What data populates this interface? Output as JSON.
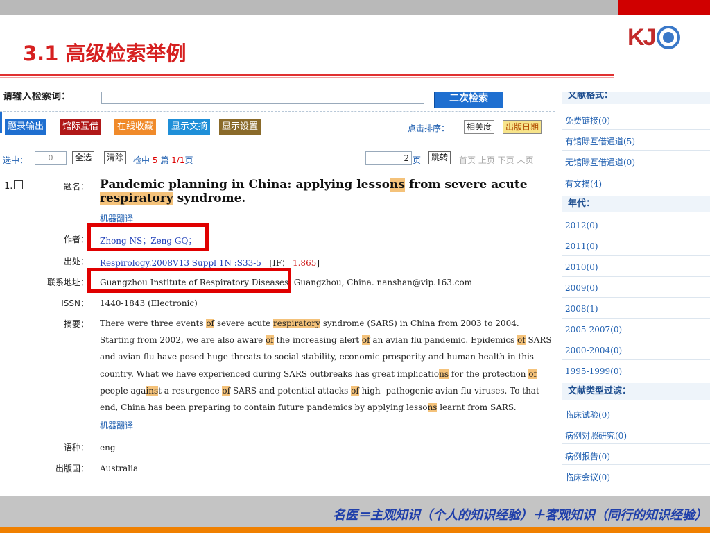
{
  "slide": {
    "title": "3.1 高级检索举例",
    "logo_text": "KJ",
    "footer": "名医＝主观知识（个人的知识经验）＋客观知识（同行的知识经验）"
  },
  "search": {
    "label": "请输入检索词：",
    "button": "二次检索"
  },
  "toolbar": {
    "buttons": [
      "题录输出",
      "馆际互借",
      "在线收藏",
      "显示文摘",
      "显示设置"
    ],
    "colors": [
      "#1f6fd0",
      "#b01818",
      "#f08a2a",
      "#1f8fd8",
      "#8a6a2a"
    ],
    "sort_label": "点击排序：",
    "sort_relevance": "相关度",
    "sort_date": "出版日期"
  },
  "selection": {
    "label": "选中：",
    "count": "0",
    "select_all": "全选",
    "clear": "清除",
    "hits_prefix": "检中",
    "hits_count": "5",
    "hits_mid": "篇",
    "page_pos": "1/1",
    "page_suffix": "页",
    "page_input": "2",
    "page_unit": "页",
    "jump": "跳转",
    "pager": "首页 上页 下页 末页"
  },
  "record": {
    "index": "1.",
    "labels": {
      "title": "题名：",
      "author": "作者：",
      "source": "出处：",
      "address": "联系地址：",
      "issn": "ISSN：",
      "abstract": "摘要：",
      "language": "语种：",
      "country": "出版国："
    },
    "title_parts": [
      "Pandemic planning in China: applying lesso",
      "ns",
      " from severe acute "
    ],
    "title_hl2": "respiratory",
    "title_end": " syndrome.",
    "machine_translate": "机器翻译",
    "authors": "Zhong NS；Zeng GQ；",
    "source_text": "Respirology.2008V13 Suppl 1N :S33-5",
    "if_label": "[IF：",
    "if_value": "1.865",
    "if_close": "]",
    "address": "Guangzhou Institute of Respiratory Diseases, Guangzhou, China. nanshan@vip.163.com",
    "issn": "1440-1843 (Electronic)",
    "abstract": "There were three events of severe acute respiratory syndrome (SARS) in China from 2003 to 2004. Starting from 2002, we are also aware of the increasing alert of an avian flu pandemic. Epidemics of SARS and avian flu have posed huge threats to social stability, economic prosperity and human health in this country. What we have experienced during SARS outbreaks has great implications for the protection of people against a resurgence of SARS and potential attacks of high- pathogenic avian flu viruses. To that end, China has been preparing to contain future pandemics by applying lessons learnt from SARS.",
    "language": "eng",
    "country": "Australia"
  },
  "sidebar": {
    "top_head": "文献格式：",
    "format_items": [
      "免费链接(0)",
      "有馆际互借通道(5)",
      "无馆际互借通道(0)",
      "有文摘(4)"
    ],
    "year_head": "年代：",
    "year_items": [
      "2012(0)",
      "2011(0)",
      "2010(0)",
      "2009(0)",
      "2008(1)",
      "2005-2007(0)",
      "2000-2004(0)",
      "1995-1999(0)"
    ],
    "type_head": "文献类型过滤：",
    "type_items": [
      "临床试验(0)",
      "病例对照研究(0)",
      "病例报告(0)",
      "临床会议(0)"
    ]
  }
}
